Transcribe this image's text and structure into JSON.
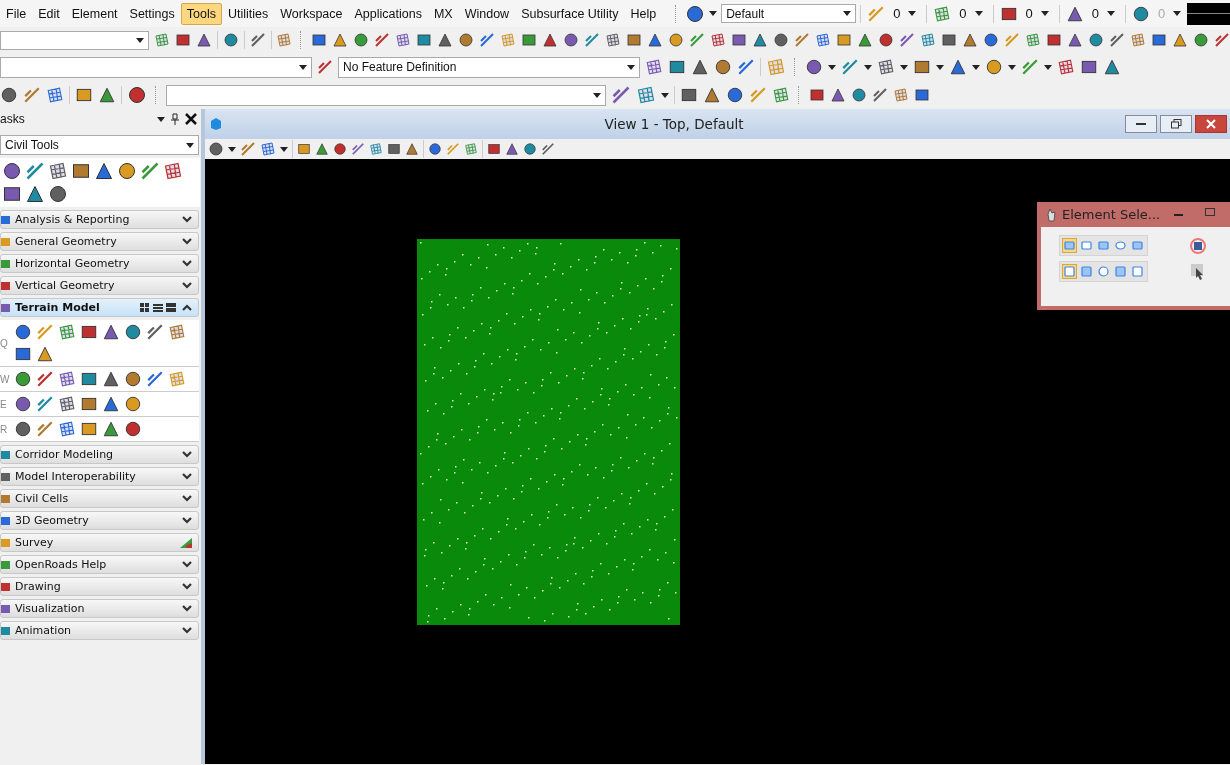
{
  "menu_bar": {
    "items": [
      {
        "label": "File",
        "selected": false
      },
      {
        "label": "Edit",
        "selected": false
      },
      {
        "label": "Element",
        "selected": false
      },
      {
        "label": "Settings",
        "selected": false
      },
      {
        "label": "Tools",
        "selected": true
      },
      {
        "label": "Utilities",
        "selected": false
      },
      {
        "label": "Workspace",
        "selected": false
      },
      {
        "label": "Applications",
        "selected": false
      },
      {
        "label": "MX",
        "selected": false
      },
      {
        "label": "Window",
        "selected": false
      },
      {
        "label": "Subsurface Utility",
        "selected": false
      },
      {
        "label": "Help",
        "selected": false
      }
    ]
  },
  "attributes_toolbar": {
    "level": "Default",
    "counters": [
      {
        "value": "0",
        "disabled": false
      },
      {
        "value": "0",
        "disabled": false
      },
      {
        "value": "0",
        "disabled": false
      },
      {
        "value": "0",
        "disabled": false
      },
      {
        "value": "0",
        "disabled": true
      }
    ]
  },
  "feature_toolbar": {
    "feature_definition": "No Feature Definition"
  },
  "tasks_panel": {
    "title": "asks",
    "tool_set": "Civil Tools",
    "sections": [
      {
        "label": "Analysis & Reporting",
        "kind": "collapsible",
        "expanded": false
      },
      {
        "label": "General Geometry",
        "kind": "collapsible",
        "expanded": false
      },
      {
        "label": "Horizontal Geometry",
        "kind": "collapsible",
        "expanded": false
      },
      {
        "label": "Vertical Geometry",
        "kind": "collapsible",
        "expanded": false
      },
      {
        "label": "Terrain Model",
        "kind": "collapsible",
        "expanded": true,
        "rows": [
          {
            "key": "Q"
          },
          {
            "key": "W"
          },
          {
            "key": "E"
          },
          {
            "key": "R"
          }
        ]
      },
      {
        "label": "Corridor Modeling",
        "kind": "collapsible",
        "expanded": false
      },
      {
        "label": "Model Interoperability",
        "kind": "collapsible",
        "expanded": false
      },
      {
        "label": "Civil Cells",
        "kind": "collapsible",
        "expanded": false
      },
      {
        "label": "3D Geometry",
        "kind": "collapsible",
        "expanded": false
      },
      {
        "label": "Survey",
        "kind": "status",
        "expanded": false
      },
      {
        "label": "OpenRoads Help",
        "kind": "collapsible",
        "expanded": false
      },
      {
        "label": "Drawing",
        "kind": "collapsible",
        "expanded": false
      },
      {
        "label": "Visualization",
        "kind": "collapsible",
        "expanded": false
      },
      {
        "label": "Animation",
        "kind": "collapsible",
        "expanded": false
      }
    ]
  },
  "view_window": {
    "title": "View 1 - Top, Default"
  },
  "element_selection": {
    "title": "Element Sele...",
    "methods": [
      {
        "selected": true
      },
      {
        "selected": false
      },
      {
        "selected": false
      },
      {
        "selected": false
      },
      {
        "selected": false
      }
    ],
    "modes": [
      {
        "selected": true
      },
      {
        "selected": false
      },
      {
        "selected": false
      },
      {
        "selected": false
      },
      {
        "selected": false
      }
    ]
  }
}
